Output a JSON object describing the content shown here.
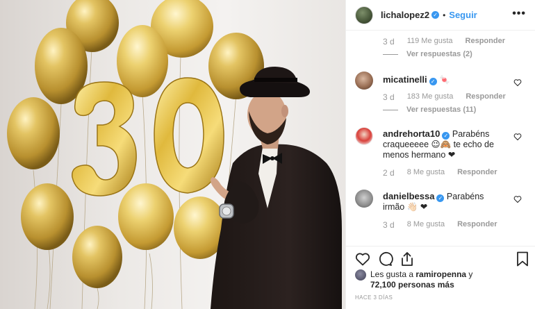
{
  "header": {
    "username": "lichalopez2",
    "separator": "•",
    "follow_label": "Seguir",
    "more_label": "•••"
  },
  "verified_badge": "✓",
  "comments": [
    {
      "meta": {
        "age": "3 d",
        "likes": "119 Me gusta",
        "reply": "Responder"
      },
      "view_replies": "Ver respuestas (2)"
    },
    {
      "username": "micatinelli",
      "text": "🍬",
      "meta": {
        "age": "3 d",
        "likes": "183 Me gusta",
        "reply": "Responder"
      },
      "view_replies": "Ver respuestas (11)"
    },
    {
      "username": "andrehorta10",
      "text": "Parabéns craqueeeee 😉🙈 te echo de menos hermano ❤",
      "meta": {
        "age": "2 d",
        "likes": "8 Me gusta",
        "reply": "Responder"
      }
    },
    {
      "username": "danielbessa",
      "text": "Parabéns irmão 👋🏻 ❤",
      "meta": {
        "age": "3 d",
        "likes": "8 Me gusta",
        "reply": "Responder"
      }
    }
  ],
  "likes": {
    "prefix": "Les gusta a ",
    "user": "ramiropenna",
    "middle": " y ",
    "others": "72,100 personas más"
  },
  "time_ago": "HACE 3 DÍAS",
  "colors": {
    "link": "#3897f0",
    "muted": "#999999",
    "text": "#262626",
    "heart_red": "#c0342e",
    "balloon_gold": "#d4b04a"
  }
}
